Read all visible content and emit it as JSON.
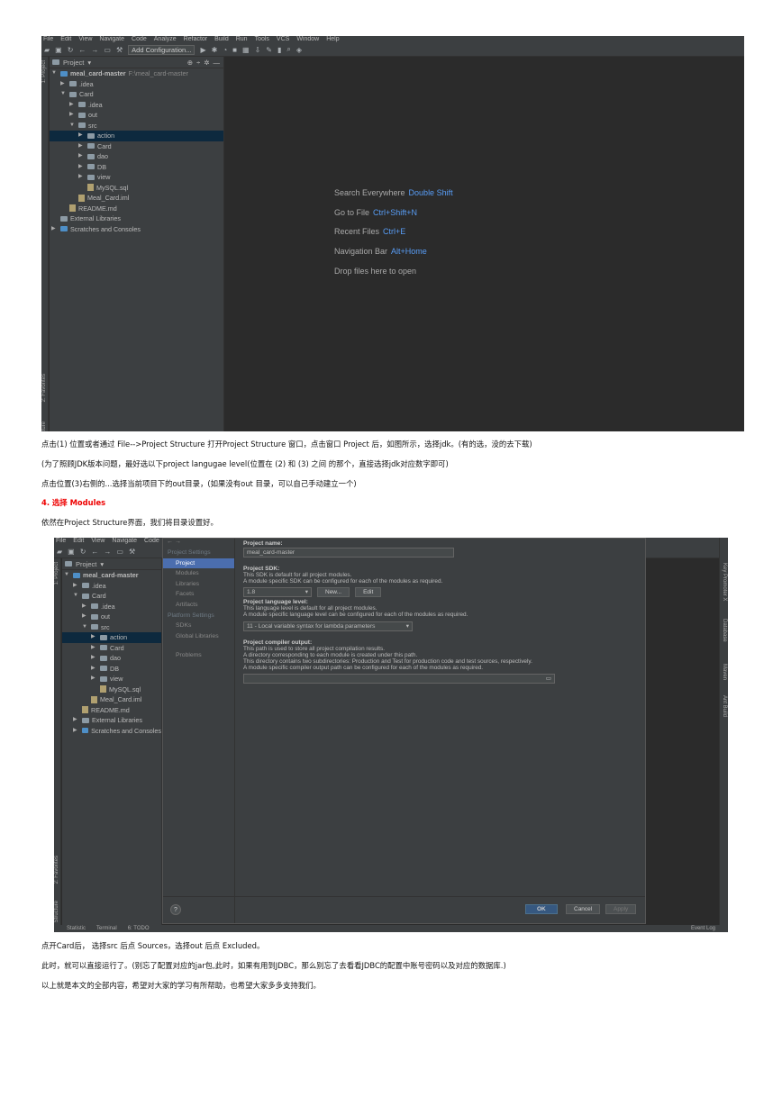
{
  "ide": {
    "menu": [
      "File",
      "Edit",
      "View",
      "Navigate",
      "Code",
      "Analyze",
      "Refactor",
      "Build",
      "Run",
      "Tools",
      "VCS",
      "Window",
      "Help"
    ],
    "add_configuration": "Add Configuration...",
    "panel_title": "Project",
    "side_tabs": {
      "project": "1: Project",
      "favorites": "2: Favorites",
      "structure": "Structure"
    },
    "tree": {
      "root": "meal_card-master",
      "root_path": "F:\\meal_card-master",
      "idea": ".idea",
      "card": "Card",
      "card_idea": ".idea",
      "out": "out",
      "src": "src",
      "action": "action",
      "card_pkg": "Card",
      "dao": "dao",
      "db": "DB",
      "view": "view",
      "mysql": "MySQL.sql",
      "iml": "Meal_Card.iml",
      "readme": "README.md",
      "ext": "External Libraries",
      "scratch": "Scratches and Consoles"
    },
    "hints": [
      {
        "text": "Search Everywhere",
        "key": "Double Shift"
      },
      {
        "text": "Go to File",
        "key": "Ctrl+Shift+N"
      },
      {
        "text": "Recent Files",
        "key": "Ctrl+E"
      },
      {
        "text": "Navigation Bar",
        "key": "Alt+Home"
      },
      {
        "text": "Drop files here to open",
        "key": ""
      }
    ]
  },
  "dialog": {
    "nav": {
      "project_settings": "Project Settings",
      "project": "Project",
      "modules": "Modules",
      "libraries": "Libraries",
      "facets": "Facets",
      "artifacts": "Artifacts",
      "platform_settings": "Platform Settings",
      "sdks": "SDKs",
      "global_libraries": "Global Libraries",
      "problems": "Problems"
    },
    "project_name_label": "Project name:",
    "project_name_value": "meal_card-master",
    "sdk_label": "Project SDK:",
    "sdk_desc1": "This SDK is default for all project modules.",
    "sdk_desc2": "A module specific SDK can be configured for each of the modules as required.",
    "sdk_value": "1.8",
    "new_btn": "New...",
    "edit_btn": "Edit",
    "lang_label": "Project language level:",
    "lang_desc1": "This language level is default for all project modules.",
    "lang_desc2": "A module specific language level can be configured for each of the modules as required.",
    "lang_value": "11 - Local variable syntax for lambda parameters",
    "out_label": "Project compiler output:",
    "out_desc1": "This path is used to store all project compilation results.",
    "out_desc2": "A directory corresponding to each module is created under this path.",
    "out_desc3": "This directory contains two subdirectories: Production and Test for production code and test sources, respectively.",
    "out_desc4": "A module specific compiler output path can be configured for each of the modules as required.",
    "ok": "OK",
    "cancel": "Cancel",
    "apply": "Apply",
    "help": "?",
    "right_tabs": [
      "Key Promoter X",
      "Database",
      "Maven",
      "Ant Build"
    ],
    "status": [
      "Statistic",
      "Terminal",
      "6: TODO",
      "Event Log"
    ]
  },
  "doc": {
    "p1": "点击(1) 位置或者通过 File-->Project Structure 打开Project Structure 窗口，点击窗口 Project 后，如图所示，选择jdk。(有的选，没的去下载)",
    "p2": "(为了照顾JDK版本问题，最好选以下project langugae level(位置在 (2) 和 (3) 之间 的那个，直接选择jdk对应数字即可)",
    "p3": "点击位置(3)右侧的...选择当前项目下的out目录，(如果没有out 目录，可以自己手动建立一个)",
    "h4": "4. 选择 Modules",
    "p4": "依然在Project Structure界面，我们将目录设置好。",
    "p5": "点开Card后， 选择src 后点 Sources，选择out 后点 Excluded。",
    "p6": "此时，就可以直接运行了。(别忘了配置对应的jar包,此时，如果有用到JDBC，那么别忘了去看看JDBC的配置中账号密码以及对应的数据库.)",
    "p7": "以上就是本文的全部内容，希望对大家的学习有所帮助，也希望大家多多支持我们。"
  }
}
